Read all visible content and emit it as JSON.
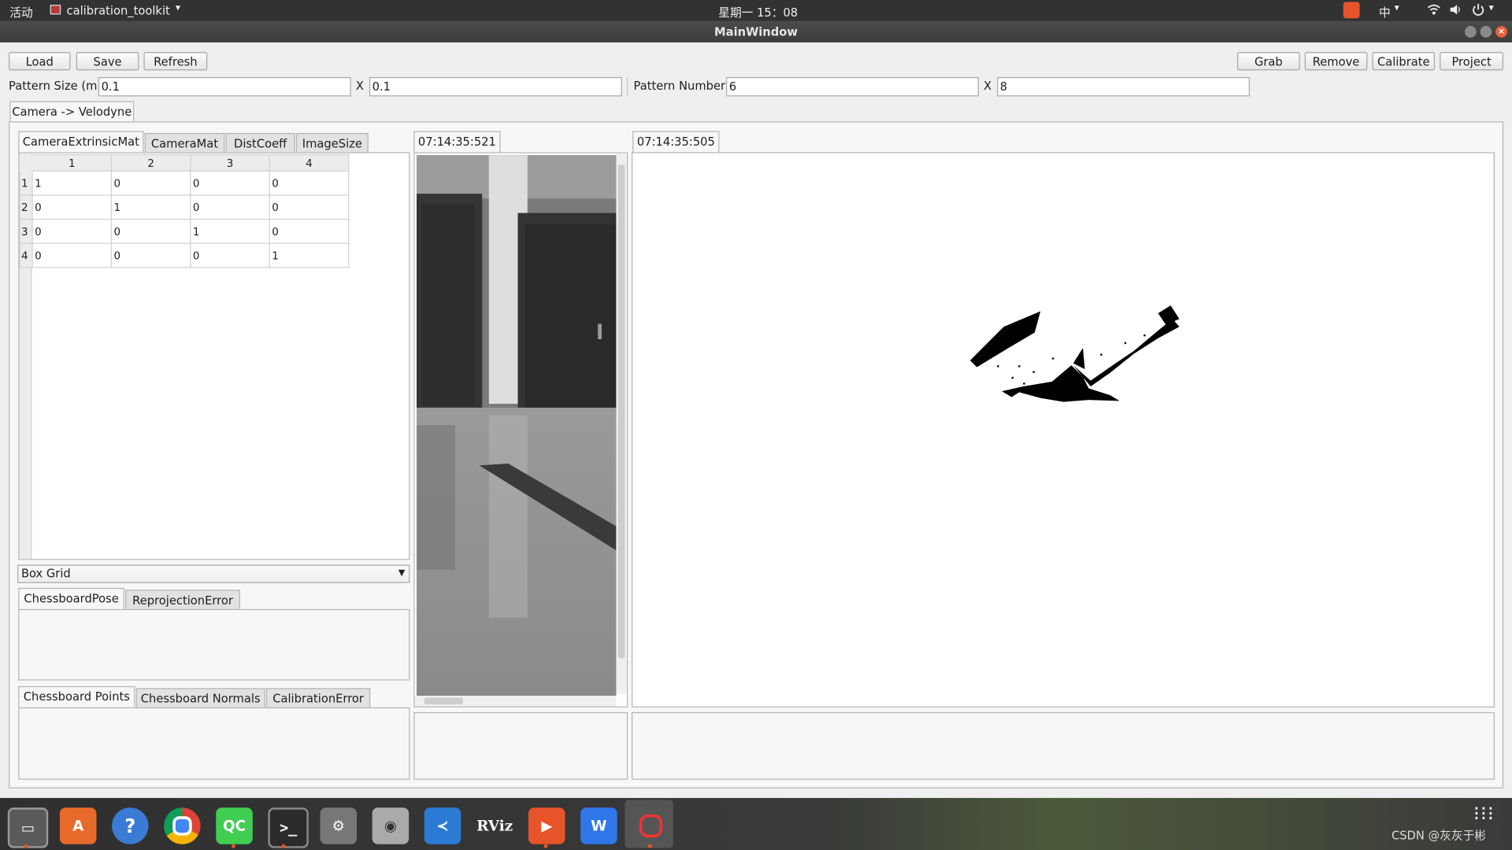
{
  "topbar": {
    "activities": "活动",
    "app_name": "calibration_toolkit",
    "clock": "星期一 15：08",
    "input_method": "中"
  },
  "window": {
    "title": "MainWindow"
  },
  "toolbar": {
    "load": "Load",
    "save": "Save",
    "refresh": "Refresh",
    "grab": "Grab",
    "remove": "Remove",
    "calibrate": "Calibrate",
    "project": "Project"
  },
  "pattern": {
    "size_label": "Pattern Size (m)",
    "size_x": "0.1",
    "size_sep": "X",
    "size_y": "0.1",
    "number_label": "Pattern Number",
    "number_x": "6",
    "number_sep": "X",
    "number_y": "8"
  },
  "main_tab": "Camera -> Velodyne",
  "matrix_tabs": [
    "CameraExtrinsicMat",
    "CameraMat",
    "DistCoeff",
    "ImageSize"
  ],
  "matrix": {
    "columns": [
      "1",
      "2",
      "3",
      "4"
    ],
    "rows": [
      {
        "h": "1",
        "c": [
          "1",
          "0",
          "0",
          "0"
        ]
      },
      {
        "h": "2",
        "c": [
          "0",
          "1",
          "0",
          "0"
        ]
      },
      {
        "h": "3",
        "c": [
          "0",
          "0",
          "1",
          "0"
        ]
      },
      {
        "h": "4",
        "c": [
          "0",
          "0",
          "0",
          "1"
        ]
      }
    ]
  },
  "grid_select": "Box Grid",
  "pose_tabs": [
    "ChessboardPose",
    "ReprojectionError"
  ],
  "points_tabs": [
    "Chessboard Points",
    "Chessboard Normals",
    "CalibrationError"
  ],
  "image_tab": "07:14:35:521",
  "cloud_tab": "07:14:35:505",
  "watermark": "CSDN @灰灰于彬",
  "dock": [
    "files-icon",
    "software-icon",
    "help-icon",
    "chrome-icon",
    "qtcreator-icon",
    "terminal-icon",
    "settings-icon",
    "camera-icon",
    "vscode-icon",
    "rviz-icon",
    "xmind-icon",
    "wps-icon",
    "recorder-icon"
  ]
}
